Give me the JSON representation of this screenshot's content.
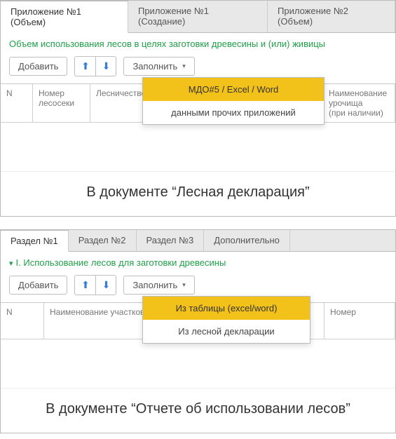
{
  "top": {
    "tabs": [
      "Приложение №1 (Объем)",
      "Приложение №1 (Создание)",
      "Приложение №2 (Объем)"
    ],
    "section_title": "Объем использования лесов в целях заготовки древесины и (или) живицы",
    "toolbar": {
      "add": "Добавить",
      "fill": "Заполнить"
    },
    "popup": {
      "item1": "МДО#5 / Excel / Word",
      "item2": "данными прочих приложений"
    },
    "columns": {
      "n": "N",
      "c1": "Номер лесосеки",
      "c2": "Лесничество",
      "c3a": "Наименование",
      "c3b": "урочища",
      "c3c": "(при наличии)"
    },
    "caption": "В документе “Лесная декларация”"
  },
  "bottom": {
    "tabs": [
      "Раздел №1",
      "Раздел №2",
      "Раздел №3",
      "Дополнительно"
    ],
    "section_title": "I. Использование лесов для заготовки древесины",
    "toolbar": {
      "add": "Добавить",
      "fill": "Заполнить"
    },
    "popup": {
      "item1": "Из таблицы (excel/word)",
      "item2": "Из лесной декларации"
    },
    "columns": {
      "n": "N",
      "c1": "Наименование участкового лесничества",
      "c2": "Номер"
    },
    "caption": "В документе “Отчете об использовании лесов”"
  }
}
